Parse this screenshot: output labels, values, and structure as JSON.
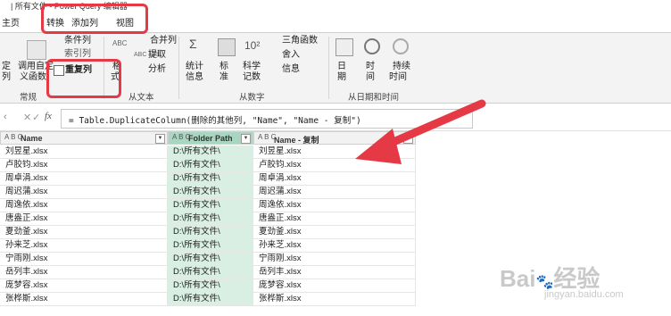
{
  "window": {
    "title": "| 所有文件 - Power Query 编辑器"
  },
  "tabs": [
    {
      "label": "主页"
    },
    {
      "label": "转换"
    },
    {
      "label": "添加列"
    },
    {
      "label": "视图"
    }
  ],
  "ribbon": {
    "custom_col_partial": "定",
    "custom_col_partial2": "列",
    "invoke_func_line1": "调用自定",
    "invoke_func_line2": "义函数",
    "conditional_col": "条件列",
    "index_col": "索引列",
    "duplicate_col": "重复列",
    "format_line1": "格",
    "format_line2": "式",
    "merge_cols": "合并列",
    "extract": "提取",
    "parse": "分析",
    "stats_line1": "统计",
    "stats_line2": "信息",
    "standard_line1": "标",
    "standard_line2": "准",
    "scientific_line1": "科学",
    "scientific_line2": "记数",
    "trig": "三角函数",
    "rounding": "舍入",
    "information": "信息",
    "date_line1": "日",
    "date_line2": "期",
    "time_line1": "时",
    "time_line2": "间",
    "duration_line1": "持续",
    "duration_line2": "时间",
    "group_general": "常规",
    "group_text": "从文本",
    "group_number": "从数字",
    "group_datetime": "从日期和时间",
    "abc_label": "ABC",
    "abc_123_label": "ABC 123",
    "ten_squared": "10²"
  },
  "formula": {
    "text": "= Table.DuplicateColumn(删除的其他列, \"Name\", \"Name - 复制\")"
  },
  "grid": {
    "columns": [
      {
        "type": "A B C",
        "name": "Name"
      },
      {
        "type": "A B C",
        "name": "Folder Path"
      },
      {
        "type": "A B C",
        "name": "Name - 复制"
      }
    ],
    "rows": [
      [
        "刘昱星.xlsx",
        "D:\\所有文件\\",
        "刘昱星.xlsx"
      ],
      [
        "卢胶钧.xlsx",
        "D:\\所有文件\\",
        "卢胶钧.xlsx"
      ],
      [
        "周卓涓.xlsx",
        "D:\\所有文件\\",
        "周卓涓.xlsx"
      ],
      [
        "周迟蒲.xlsx",
        "D:\\所有文件\\",
        "周迟蒲.xlsx"
      ],
      [
        "周逸依.xlsx",
        "D:\\所有文件\\",
        "周逸依.xlsx"
      ],
      [
        "唐盎正.xlsx",
        "D:\\所有文件\\",
        "唐盎正.xlsx"
      ],
      [
        "夏劲釜.xlsx",
        "D:\\所有文件\\",
        "夏劲釜.xlsx"
      ],
      [
        "孙来芝.xlsx",
        "D:\\所有文件\\",
        "孙来芝.xlsx"
      ],
      [
        "宁雨刚.xlsx",
        "D:\\所有文件\\",
        "宁雨刚.xlsx"
      ],
      [
        "岳列丰.xlsx",
        "D:\\所有文件\\",
        "岳列丰.xlsx"
      ],
      [
        "庞梦容.xlsx",
        "D:\\所有文件\\",
        "庞梦容.xlsx"
      ],
      [
        "张桦斯.xlsx",
        "D:\\所有文件\\",
        "张桦斯.xlsx"
      ]
    ]
  },
  "watermark": {
    "brand": "Bai",
    "brand2": "经验",
    "url": "jingyan.baidu.com"
  },
  "colors": {
    "annotation_red": "#e63946",
    "selected_col": "#a9d6c0"
  }
}
